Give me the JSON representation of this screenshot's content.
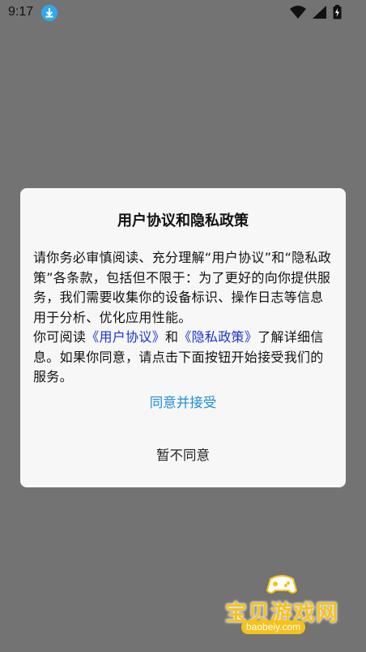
{
  "status_bar": {
    "time": "9:17",
    "icons": [
      "download-icon",
      "wifi-icon",
      "signal-icon",
      "battery-icon"
    ]
  },
  "dialog": {
    "title": "用户协议和隐私政策",
    "paragraph1": "请你务必审慎阅读、充分理解“用户协议”和“隐私政策”各条款，包括但不限于：为了更好的向你提供服务，我们需要收集你的设备标识、操作日志等信息用于分析、优化应用性能。",
    "paragraph2_prefix": "你可阅读",
    "user_agreement_link": "《用户协议》",
    "paragraph2_and": "和",
    "privacy_policy_link": "《隐私政策》",
    "paragraph2_suffix": "了解详细信息。如果你同意，请点击下面按钮开始接受我们的服务。",
    "agree_button": "同意并接受",
    "disagree_button": "暂不同意"
  },
  "watermark": {
    "text": "宝贝游戏网",
    "url": "baobeiy.com"
  },
  "colors": {
    "overlay": "#737373",
    "link": "#1a35d0",
    "agree": "#1d8fd9",
    "watermark": "#f5c21b"
  }
}
